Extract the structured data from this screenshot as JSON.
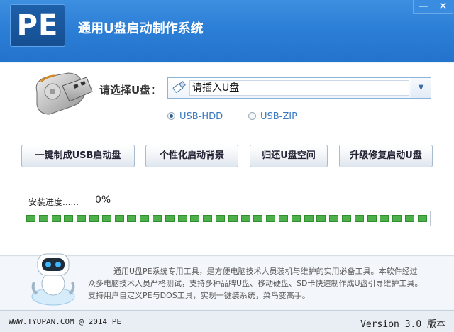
{
  "window": {
    "logo_text": "PE",
    "title": "通用U盘启动制作系统",
    "minimize_glyph": "—",
    "close_glyph": "✕"
  },
  "selector": {
    "label": "请选择U盘：",
    "value": "请插入U盘",
    "icons": [
      "usb-drive-icon",
      "usb-mini-icon",
      "chevron-down-icon"
    ]
  },
  "modes": [
    {
      "label": "USB-HDD",
      "checked": true
    },
    {
      "label": "USB-ZIP",
      "checked": false
    }
  ],
  "actions": [
    {
      "label": "一键制成USB启动盘"
    },
    {
      "label": "个性化启动背景"
    },
    {
      "label": "归还U盘空间"
    },
    {
      "label": "升级修复启动U盘"
    }
  ],
  "progress": {
    "label": "安装进度......",
    "value": "0%",
    "segments": 32
  },
  "description": {
    "line1": "通用U盘PE系统专用工具，是方便电脑技术人员装机与维护的实用必备工具。本软件经过",
    "line2": "众多电脑技术人员严格测试，支持多种品牌U盘、移动硬盘、SD卡快速制作成U盘引导维护工具。",
    "line3": "支持用户自定义PE与DOS工具，实现一键装系统，菜鸟变高手。"
  },
  "footer": {
    "copyright": "WWW.TYUPAN.COM @ 2014 PE",
    "version": "Version 3.0 版本"
  },
  "colors": {
    "titlebar": "#2c7fd6",
    "accent_text": "#3a78c0",
    "progress_green": "#4db04a"
  }
}
